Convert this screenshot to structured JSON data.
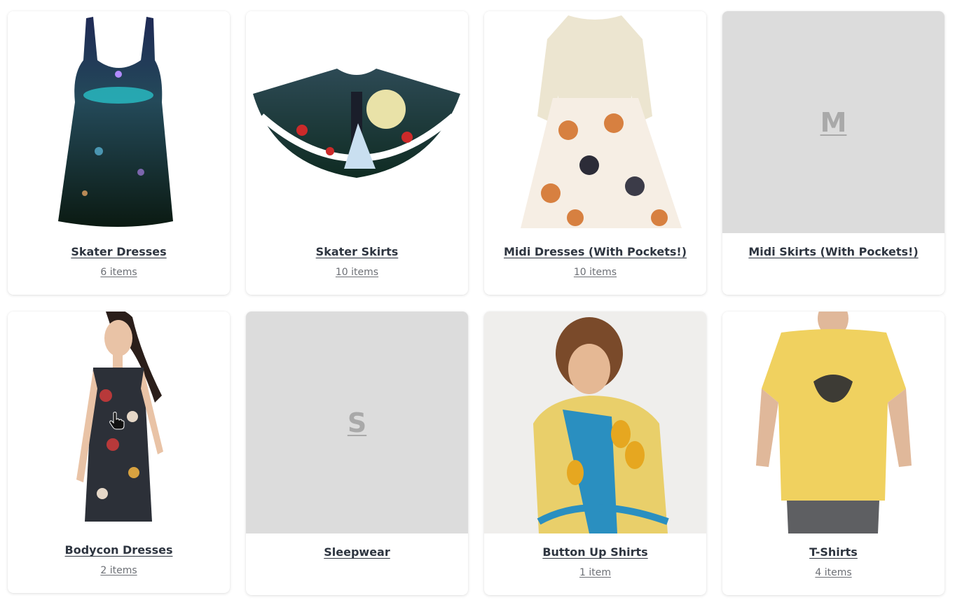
{
  "collections": [
    {
      "title": "Skater Dresses",
      "count": "6 items"
    },
    {
      "title": "Skater Skirts",
      "count": "10 items"
    },
    {
      "title": "Midi Dresses (With Pockets!)",
      "count": "10 items"
    },
    {
      "title": "Midi Skirts (With Pockets!)",
      "count": "",
      "placeholder_letter": "M"
    },
    {
      "title": "Bodycon Dresses",
      "count": "2 items"
    },
    {
      "title": "Sleepwear",
      "count": "",
      "placeholder_letter": "S"
    },
    {
      "title": "Button Up Shirts",
      "count": "1 item"
    },
    {
      "title": "T-Shirts",
      "count": "4 items"
    }
  ],
  "colors": {
    "placeholder_bg": "#dcdcdc",
    "title_text": "#2e3540",
    "count_text": "#6c6f75"
  }
}
